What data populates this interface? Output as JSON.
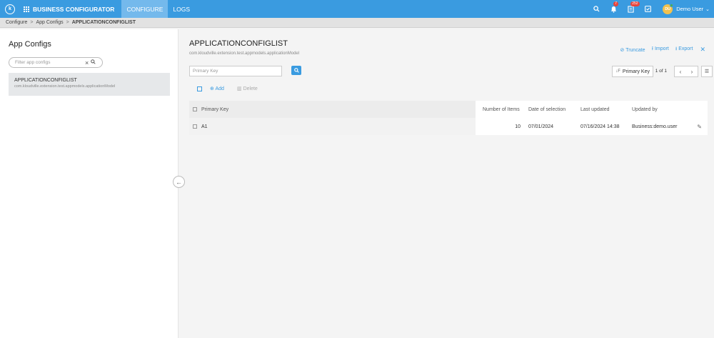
{
  "header": {
    "logo": "k",
    "app_name": "BUSINESS CONFIGURATOR",
    "tabs": [
      {
        "label": "CONFIGURE"
      },
      {
        "label": "LOGS"
      }
    ],
    "search_icon": "search-icon",
    "notifications_badge": "7",
    "tasks_badge": "252",
    "user_initials": "DU",
    "user_name": "Demo User"
  },
  "breadcrumb": {
    "items": [
      "Configure",
      "App Configs",
      "APPLICATIONCONFIGLIST"
    ]
  },
  "sidebar": {
    "title": "App Configs",
    "filter_placeholder": "Filter app configs",
    "items": [
      {
        "title": "APPLICATIONCONFIGLIST",
        "subtitle": "com.kloudville.extension.test.appmodels.applicationModel"
      }
    ]
  },
  "main": {
    "title": "APPLICATIONCONFIGLIST",
    "subtitle": "com.kloudville.extension.test.appmodels.applicationModel",
    "actions": {
      "truncate": "Truncate",
      "import": "Import",
      "export": "Export"
    },
    "search_placeholder": "Primary Key",
    "sort_label": "Primary Key",
    "pager": "1 of 1",
    "add_label": "Add",
    "delete_label": "Delete",
    "table": {
      "columns": [
        "Primary Key",
        "Number of Items",
        "Date of selection",
        "Last updated",
        "Updated by"
      ],
      "rows": [
        {
          "key": "A1",
          "items": "10",
          "date": "07/01/2024",
          "updated": "07/16/2024 14:38",
          "by": "Business:demo.user"
        }
      ]
    }
  }
}
